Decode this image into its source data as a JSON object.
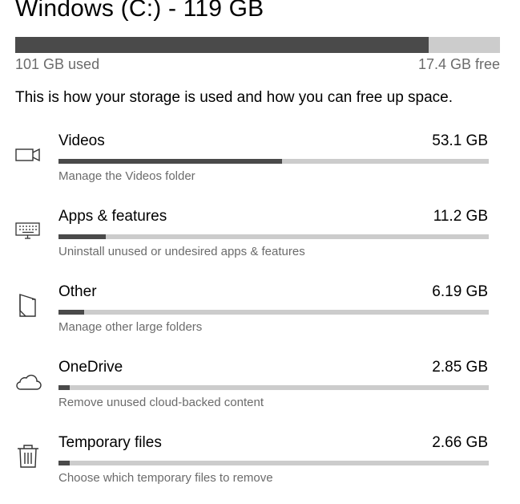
{
  "drive": {
    "title": "Windows (C:) - 119 GB",
    "used_label": "101 GB used",
    "free_label": "17.4 GB free",
    "used_fraction": 0.853
  },
  "intro": "This is how your storage is used and how you can free up space.",
  "categories": [
    {
      "icon": "video-camera-icon",
      "name": "Videos",
      "size": "53.1 GB",
      "description": "Manage the Videos folder",
      "fraction": 0.52
    },
    {
      "icon": "keyboard-icon",
      "name": "Apps & features",
      "size": "11.2 GB",
      "description": "Uninstall unused or undesired apps & features",
      "fraction": 0.11
    },
    {
      "icon": "folder-icon",
      "name": "Other",
      "size": "6.19 GB",
      "description": "Manage other large folders",
      "fraction": 0.06
    },
    {
      "icon": "cloud-icon",
      "name": "OneDrive",
      "size": "2.85 GB",
      "description": "Remove unused cloud-backed content",
      "fraction": 0.027
    },
    {
      "icon": "trash-icon",
      "name": "Temporary files",
      "size": "2.66 GB",
      "description": "Choose which temporary files to remove",
      "fraction": 0.026
    }
  ],
  "colors": {
    "bar_fill": "#4a4a4a",
    "bar_track": "#cccccc",
    "secondary_text": "#6b6b6b"
  }
}
